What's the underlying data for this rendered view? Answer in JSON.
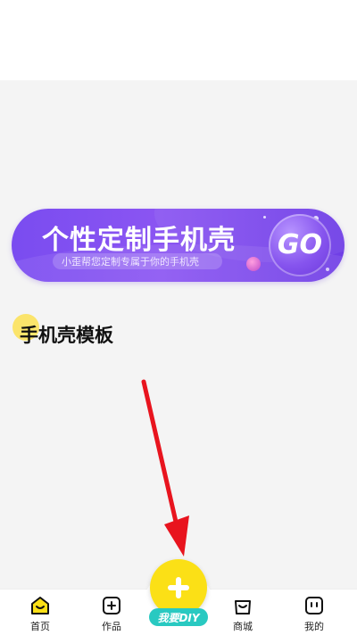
{
  "banner": {
    "title": "个性定制手机壳",
    "subtitle": "小歪帮您定制专属于你的手机壳",
    "go_label": "GO"
  },
  "section": {
    "title": "手机壳模板"
  },
  "bottom_nav": {
    "items": [
      {
        "label": "首页",
        "icon": "home-icon",
        "active": true
      },
      {
        "label": "作品",
        "icon": "add-square-icon",
        "active": false
      },
      {
        "label": "商城",
        "icon": "shopping-bag-icon",
        "active": false
      },
      {
        "label": "我的",
        "icon": "profile-icon",
        "active": false
      }
    ],
    "diy": {
      "label": "我要DIY",
      "icon": "plus-icon"
    }
  },
  "colors": {
    "banner": "#7a4cf0",
    "diy_button": "#fbe016",
    "diy_label": "#29c9c1",
    "section_dot": "#fbe46b",
    "annotation_arrow": "#e8141e",
    "home_icon_fill": "#fbe016"
  }
}
